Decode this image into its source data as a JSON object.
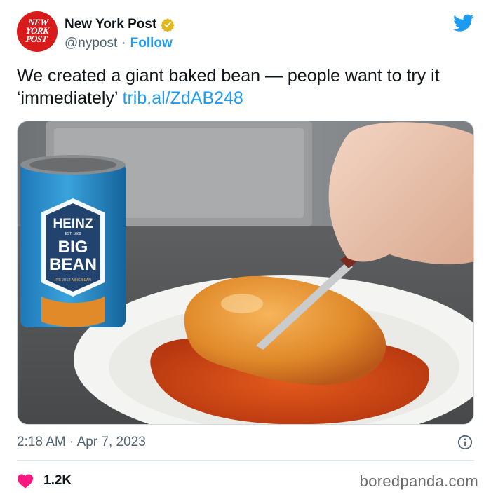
{
  "account": {
    "avatar_logo_lines": [
      "NEW",
      "YORK",
      "POST"
    ],
    "name": "New York Post",
    "handle": "@nypost",
    "separator": "·",
    "follow_label": "Follow"
  },
  "tweet": {
    "text": "We created a giant baked bean — people want to try it ‘immediately’ ",
    "link": "trib.al/ZdAB248"
  },
  "media": {
    "can_brand": "HEINZ",
    "can_small_text": "EST. 1869",
    "can_product_line1": "BIG",
    "can_product_line2": "BEAN",
    "can_tagline": "IT'S JUST A BIG BEAN"
  },
  "meta": {
    "time": "2:18 AM",
    "separator": "·",
    "date": "Apr 7, 2023"
  },
  "engagement": {
    "likes": "1.2K"
  },
  "watermark": "boredpanda.com",
  "colors": {
    "accent": "#1d9bf0",
    "brand_red": "#d81a1a",
    "heart": "#f91880",
    "verified_gold": "#e2b719"
  },
  "icons": {
    "verified": "verified-badge-icon",
    "bird": "twitter-bird-icon",
    "info": "info-icon",
    "heart": "heart-icon"
  }
}
